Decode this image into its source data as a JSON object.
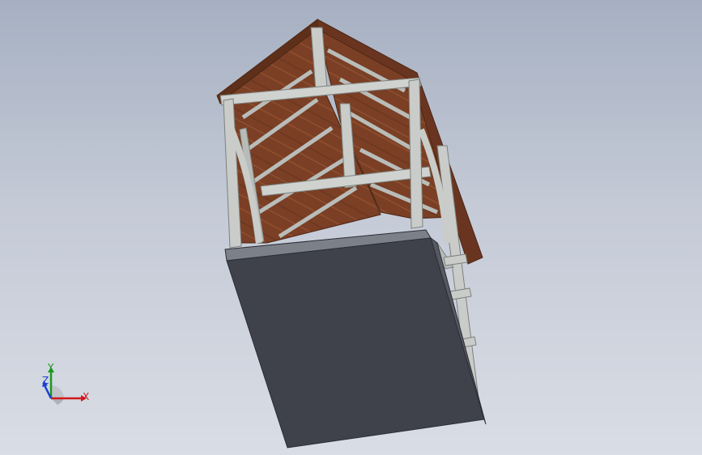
{
  "viewport": {
    "background_top": "#a6b0c2",
    "background_bottom": "#d9dde5"
  },
  "model": {
    "description_icon": "timber-frame-gazebo-model",
    "colors": {
      "roof_panel": "#7a3f24",
      "roof_edge": "#5e3019",
      "timber": "#c9ccc9",
      "timber_shadow": "#9ea29f",
      "base_slab": "#3f424b",
      "base_edge": "#2c2e35"
    }
  },
  "triad": {
    "x_label": "X",
    "y_label": "Y",
    "z_label": "Z",
    "x_color": "#d11a1a",
    "y_color": "#1a9a1a",
    "z_color": "#1a3fd1"
  }
}
